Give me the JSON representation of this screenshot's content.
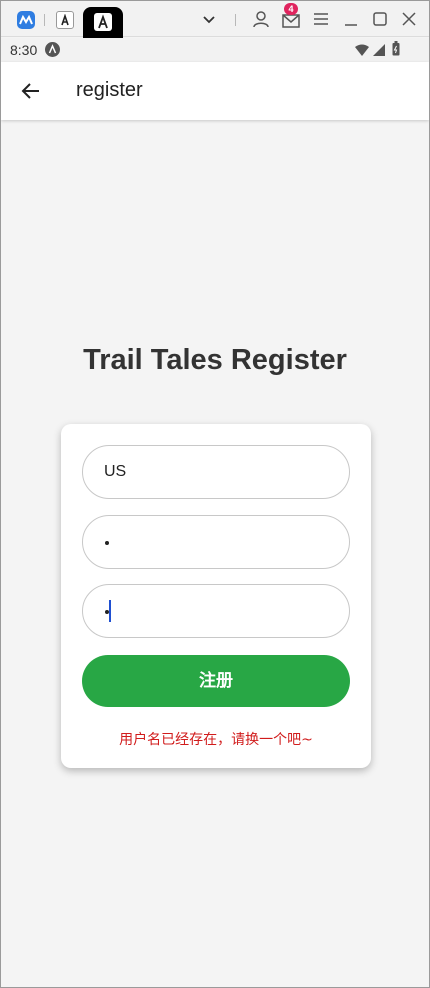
{
  "emulator": {
    "notification_count": "4"
  },
  "status_bar": {
    "time": "8:30"
  },
  "app_bar": {
    "title": "register"
  },
  "main": {
    "title": "Trail Tales Register",
    "username_value": "US",
    "submit_label": "注册",
    "error_message": "用户名已经存在，请换一个吧~"
  },
  "colors": {
    "button": "#28a745",
    "error": "#d11c1c",
    "caret": "#1f4fd1"
  }
}
